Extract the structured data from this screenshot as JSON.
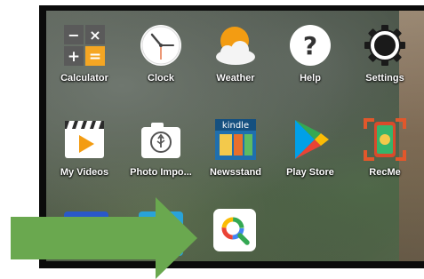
{
  "apps": [
    {
      "label": "Calculator",
      "icon": "calculator-icon"
    },
    {
      "label": "Clock",
      "icon": "clock-icon"
    },
    {
      "label": "Weather",
      "icon": "weather-icon"
    },
    {
      "label": "Help",
      "icon": "help-icon"
    },
    {
      "label": "Settings",
      "icon": "settings-icon"
    },
    {
      "label": "My Videos",
      "icon": "video-icon"
    },
    {
      "label": "Photo Impo...",
      "icon": "photo-import-icon"
    },
    {
      "label": "Newsstand",
      "icon": "kindle-newsstand-icon"
    },
    {
      "label": "Play Store",
      "icon": "play-store-icon"
    },
    {
      "label": "RecMe",
      "icon": "recme-icon"
    },
    {
      "label": "",
      "icon": "search-app-icon"
    }
  ],
  "calculator": {
    "minus": "−",
    "times": "×",
    "plus": "+",
    "equals": "="
  },
  "help": {
    "symbol": "?"
  },
  "newsstand": {
    "brand": "kindle"
  },
  "colors": {
    "arrow": "#6aa84f",
    "calculator_orange": "#f5a623",
    "frame": "#0b0b0b"
  }
}
